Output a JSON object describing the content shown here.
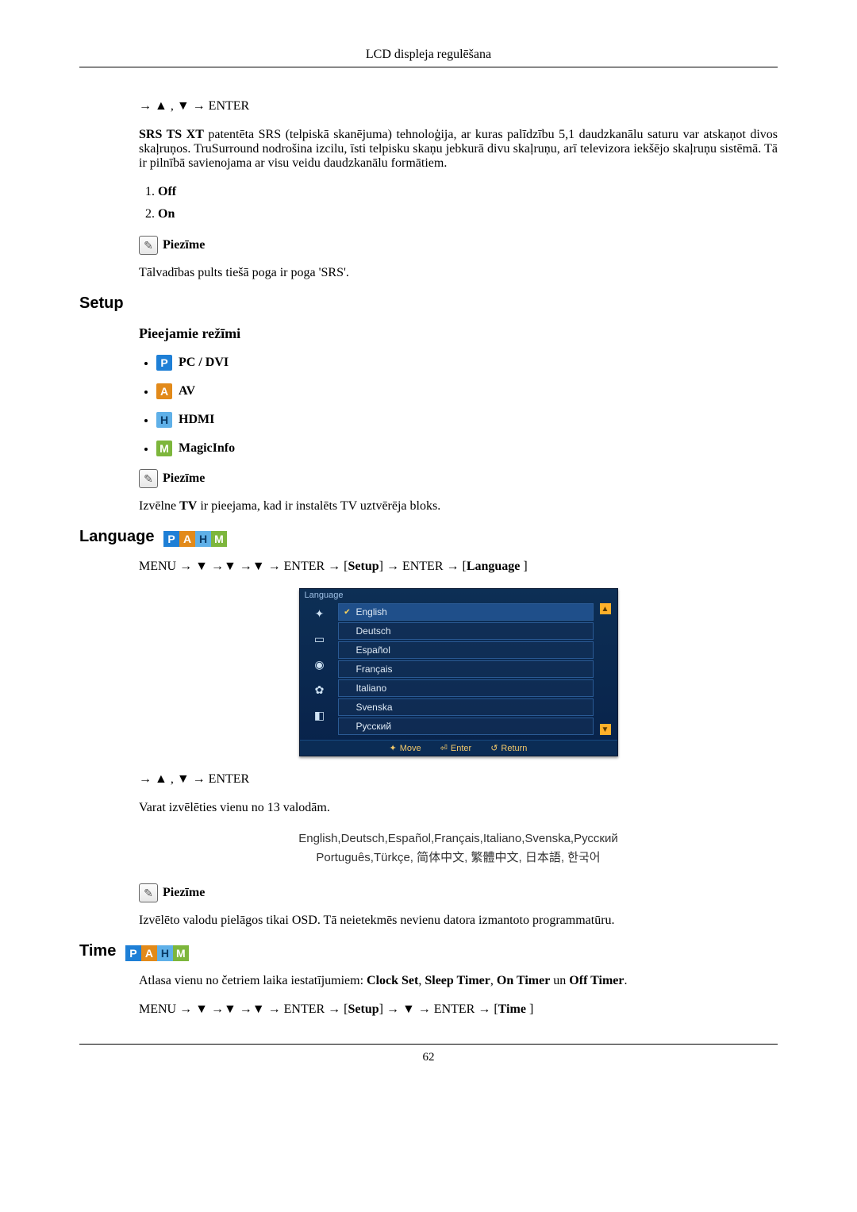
{
  "header": {
    "title": "LCD displeja regulēšana"
  },
  "srs": {
    "nav": "→ ▲ , ▼ → ENTER",
    "lead_bold": "SRS TS XT",
    "lead_rest": " patentēta SRS (telpiskā skanējuma) tehnoloģija, ar kuras palīdzību 5,1 daudzkanālu saturu var atskaņot divos skaļruņos. TruSurround nodrošina izcilu, īsti telpisku skaņu jebkurā divu skaļruņu, arī televizora iekšējo skaļruņu sistēmā. Tā ir pilnībā savienojama ar visu veidu daudzkanālu formātiem.",
    "opt1": "Off",
    "opt2": "On",
    "note_label": "Piezīme",
    "note_text": "Tālvadības pults tiešā poga ir poga 'SRS'."
  },
  "setup": {
    "heading": "Setup",
    "modes_heading": "Pieejamie režīmi",
    "modes": [
      {
        "letter": "P",
        "cls": "badge-p",
        "label": "PC / DVI"
      },
      {
        "letter": "A",
        "cls": "badge-a",
        "label": "AV"
      },
      {
        "letter": "H",
        "cls": "badge-h",
        "label": "HDMI"
      },
      {
        "letter": "M",
        "cls": "badge-m",
        "label": "MagicInfo"
      }
    ],
    "note_label": "Piezīme",
    "note_pre": "Izvēlne ",
    "note_bold": "TV",
    "note_post": " ir pieejama, kad ir instalēts TV uztvērēja bloks."
  },
  "language": {
    "heading": "Language",
    "nav_full": "MENU → ▼ →▼ →▼ → ENTER → [Setup] → ENTER → [Language ]",
    "nav_pre": "MENU → ▼ →▼ →▼ → ENTER → [",
    "nav_b1": "Setup",
    "nav_mid1": "] → ENTER → [",
    "nav_b2": "Language",
    "nav_post": " ]",
    "osd_title": "Language",
    "osd_items": [
      "English",
      "Deutsch",
      "Español",
      "Français",
      "Italiano",
      "Svenska",
      "Русский"
    ],
    "osd_footer": {
      "move": "Move",
      "enter": "Enter",
      "return": "Return"
    },
    "nav2": "→ ▲ , ▼ → ENTER",
    "desc": "Varat izvēlēties vienu no 13 valodām.",
    "lang_line1": "English,Deutsch,Español,Français,Italiano,Svenska,Русский",
    "lang_line2": "Português,Türkçe, 简体中文,  繁體中文, 日本語, 한국어",
    "note_label": "Piezīme",
    "note_text": "Izvēlēto valodu pielāgos tikai OSD. Tā neietekmēs nevienu datora izmantoto programmatūru."
  },
  "time": {
    "heading": "Time",
    "desc_pre": "Atlasa vienu no četriem laika iestatījumiem: ",
    "b1": "Clock Set",
    "s1": ", ",
    "b2": "Sleep Timer",
    "s2": ", ",
    "b3": "On Timer",
    "s3": " un ",
    "b4": "Off Timer",
    "s4": ".",
    "nav_pre": "MENU → ▼ →▼ →▼ → ENTER → [",
    "nav_b1": "Setup",
    "nav_mid1": "] → ▼ → ENTER → [",
    "nav_b2": "Time",
    "nav_post": " ]"
  },
  "page_number": "62"
}
